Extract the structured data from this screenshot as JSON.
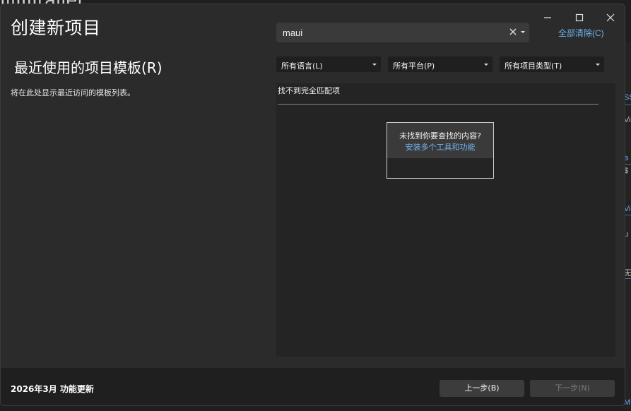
{
  "background": {
    "title_fragment": "IllIIIJtaiier",
    "right_fragments": [
      "SS",
      "Vi",
      "a",
      "$",
      "Vi",
      "u",
      "无",
      "M"
    ]
  },
  "dialog": {
    "title": "创建新项目",
    "window_controls": [
      "minimize-icon",
      "maximize-icon",
      "close-icon"
    ]
  },
  "search": {
    "value": "maui",
    "clear_icon": "close-icon",
    "dropdown_icon": "chevron-down-icon"
  },
  "clear_all_label": "全部清除(C)",
  "recent": {
    "title": "最近使用的项目模板(R)",
    "description": "将在此处显示最近访问的模板列表。"
  },
  "filters": [
    {
      "label": "所有语言(L)"
    },
    {
      "label": "所有平台(P)"
    },
    {
      "label": "所有项目类型(T)"
    }
  ],
  "results": {
    "no_match": "找不到完全匹配项",
    "help_question": "未找到你要查找的内容?",
    "help_link": "安装多个工具和功能"
  },
  "footer": {
    "update_text": "2026年3月 功能更新",
    "back_label": "上一步(B)",
    "next_label": "下一步(N)"
  },
  "colors": {
    "accent_link": "#6fb3f0",
    "dialog_bg": "#2b2b2b",
    "footer_bg": "#1f1f1f"
  }
}
